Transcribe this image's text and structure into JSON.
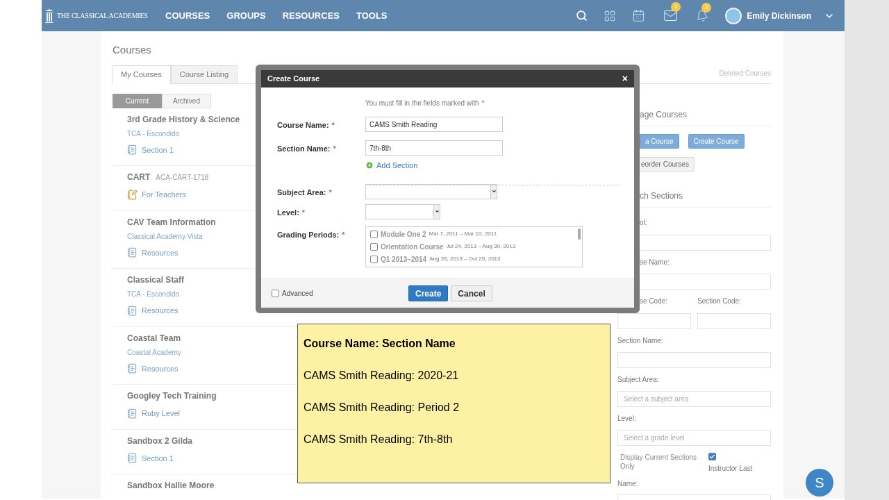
{
  "header": {
    "logo": "THE CLASSICAL ACADEMIES",
    "nav": [
      "COURSES",
      "GROUPS",
      "RESOURCES",
      "TOOLS"
    ],
    "mail_badge": "1",
    "bell_badge": "3",
    "user": "Emily Dickinson"
  },
  "page_title": "Courses",
  "tabs": [
    {
      "label": "My Courses",
      "selected": true
    },
    {
      "label": "Course Listing",
      "selected": false
    }
  ],
  "deleted_link": "Deleted Courses",
  "filters": [
    {
      "label": "Current",
      "selected": true
    },
    {
      "label": "Archived",
      "selected": false
    }
  ],
  "courses": [
    {
      "title": "3rd Grade History & Science",
      "school": "TCA - Escondido",
      "section": {
        "label": "Section 1",
        "kind": "notebook"
      }
    },
    {
      "title": "CART",
      "code": "ACA-CART-1718",
      "section": {
        "label": "For Teachers",
        "kind": "pencil"
      }
    },
    {
      "title": "CAV Team Information",
      "school": "Classical Academy Vista",
      "section": {
        "label": "Resources",
        "kind": "notebook"
      }
    },
    {
      "title": "Classical Staff",
      "school": "TCA - Escondido",
      "section": {
        "label": "Resources",
        "kind": "notebook"
      }
    },
    {
      "title": "Coastal Team",
      "school": "Coastal Academy",
      "section": {
        "label": "Resources",
        "kind": "notebook"
      }
    },
    {
      "title": "Googley Tech Training",
      "section": {
        "label": "Ruby Level",
        "kind": "notebook"
      }
    },
    {
      "title": "Sandbox 2 Gilda",
      "section": {
        "label": "Section 1",
        "kind": "notebook"
      }
    },
    {
      "title": "Sandbox Hallie Moore"
    }
  ],
  "modal": {
    "title": "Create Course",
    "close": "×",
    "required_note": "You must fill in the fields marked with",
    "required_mark": "*",
    "fields": [
      {
        "label": "Course Name:",
        "kind": "text",
        "value": "CAMS Smith Reading"
      },
      {
        "label": "Section Name:",
        "kind": "text",
        "value": "7th-8th",
        "link": "Add Section"
      },
      {
        "label": "Subject Area:",
        "kind": "wide_select"
      },
      {
        "label": "Level:",
        "kind": "narrow_select"
      },
      {
        "label": "Grading Periods:",
        "kind": "checklist",
        "items": [
          {
            "name": "Module One 2",
            "dates": "Mar 7, 2011 – Mar 10, 2011",
            "checked": false
          },
          {
            "name": "Orientation Course",
            "dates": "Jul 24, 2013 – Aug 30, 2013",
            "checked": false
          },
          {
            "name": "Q1 2013–2014",
            "dates": "Aug 26, 2013 – Oct 25, 2013",
            "checked": false
          }
        ]
      }
    ],
    "advanced": {
      "label": "Advanced",
      "checked": false
    },
    "buttons": [
      {
        "label": "Create",
        "kind": "primary"
      },
      {
        "label": "Cancel",
        "kind": "secondary"
      }
    ]
  },
  "note": {
    "heading": "Course Name: Section Name",
    "lines": [
      "CAMS Smith Reading: 2020-21",
      "CAMS Smith Reading: Period 2",
      "CAMS Smith Reading: 7th-8th"
    ]
  },
  "right_panel": {
    "manage_heading": "age Courses",
    "buttons": [
      {
        "label": "a Course",
        "kind": "primary"
      },
      {
        "label": "Create Course",
        "kind": "primary"
      },
      {
        "label": "eorder Courses",
        "kind": "secondary"
      }
    ],
    "search_heading": "ch Sections",
    "school_label": "ol:",
    "course_name_label": "se Name:",
    "course_code_label": "se Code:",
    "section_code_label": "Section Code:",
    "section_name_label": "Section Name:",
    "subject_label": "Subject Area:",
    "subject_placeholder": "Select a subject area",
    "level_label": "Level:",
    "level_placeholder": "Select a grade level",
    "current_only": {
      "label": "Display Current Sections Only",
      "checked": true
    },
    "instructor_label_1": "Instructor Last",
    "instructor_label_2": "Name:"
  },
  "chat_button": "S"
}
